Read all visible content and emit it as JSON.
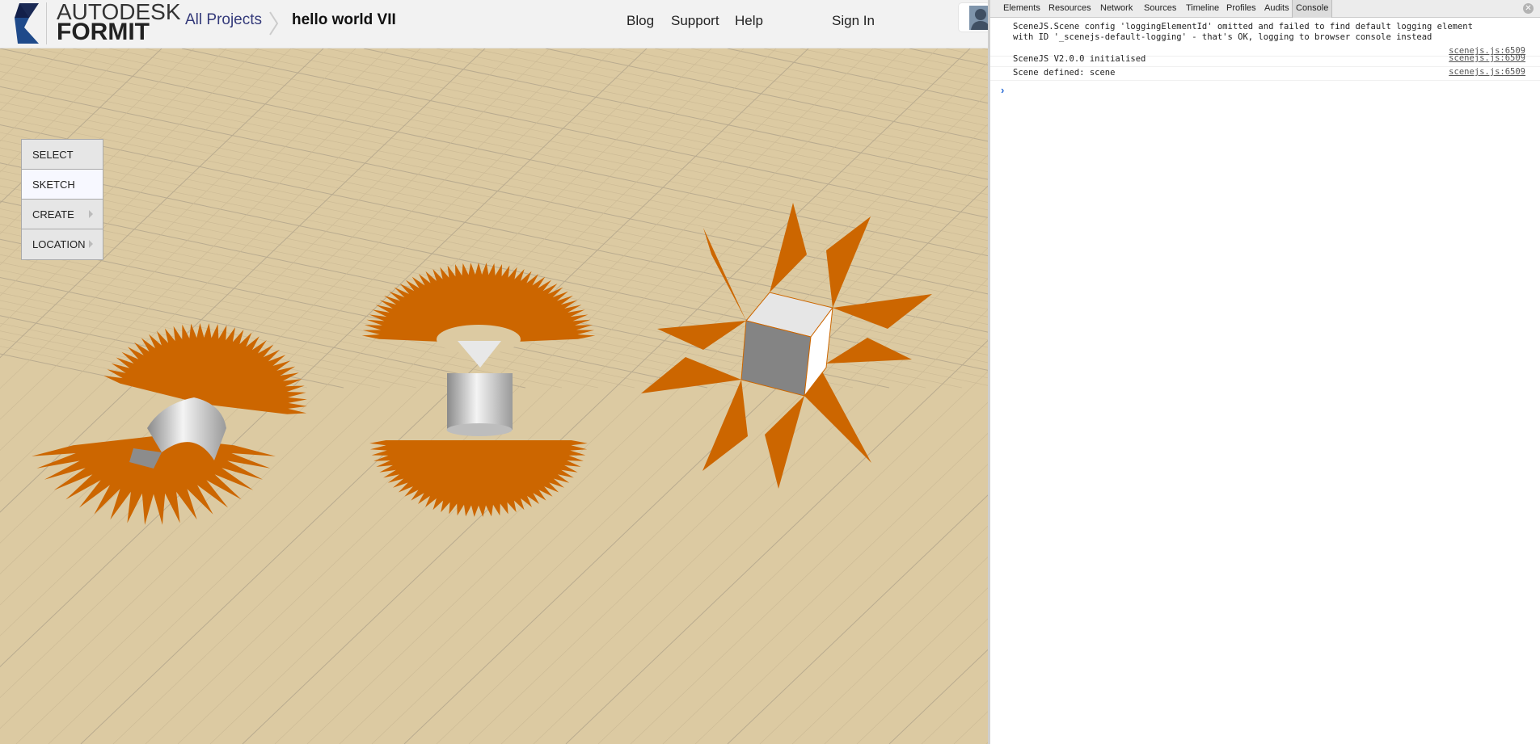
{
  "header": {
    "logo_line1": "AUTODESK",
    "logo_line2": "FORMIT",
    "breadcrumb": [
      "All Projects",
      "hello world VII"
    ],
    "nav": [
      "Blog",
      "Support",
      "Help"
    ],
    "sign_in": "Sign In"
  },
  "menu": [
    {
      "label": "SELECT",
      "active": false,
      "submenu": false
    },
    {
      "label": "SKETCH",
      "active": true,
      "submenu": false
    },
    {
      "label": "CREATE",
      "active": false,
      "submenu": true
    },
    {
      "label": "LOCATION",
      "active": false,
      "submenu": true
    }
  ],
  "devtools": {
    "tabs": [
      "Elements",
      "Resources",
      "Network",
      "Sources",
      "Timeline",
      "Profiles",
      "Audits",
      "Console"
    ],
    "active_tab": "Console",
    "console": [
      {
        "text": "SceneJS.Scene config 'loggingElementId' omitted and failed to find default logging element\nwith ID '_scenejs-default-logging' - that's OK, logging to browser console instead",
        "source": "scenejs.js:6509"
      },
      {
        "text": "SceneJS V2.0.0 initialised",
        "source": "scenejs.js:6509"
      },
      {
        "text": "Scene defined: scene",
        "source": "scenejs.js:6509"
      }
    ]
  },
  "colors": {
    "accent": "#cc6600",
    "ground": "#dccaa2",
    "header": "#f2f2f2"
  }
}
